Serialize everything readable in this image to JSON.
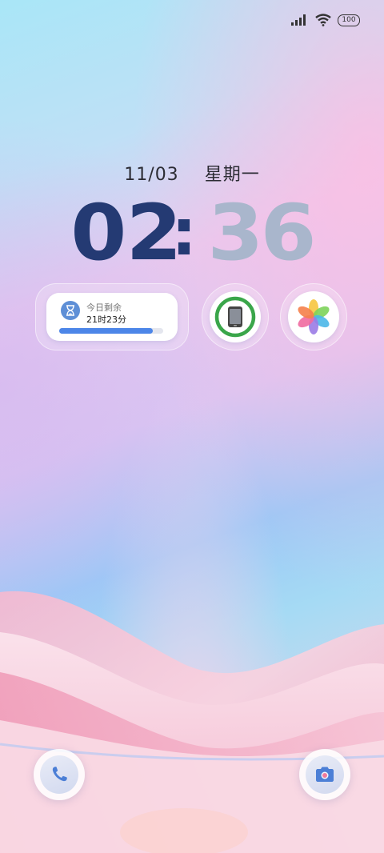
{
  "status_bar": {
    "signal_icon": "signal-icon",
    "wifi_icon": "wifi-icon",
    "battery_level": "100"
  },
  "lock_screen": {
    "date": "11/03",
    "weekday": "星期一",
    "clock": {
      "hour_digit_1": "0",
      "hour_digit_2": "2",
      "separator": ":",
      "minute_digit_1": "3",
      "minute_digit_2": "6",
      "hour_color": "#243a73",
      "minute_color": "#a9b6cc"
    }
  },
  "widgets": {
    "screen_time": {
      "icon": "hourglass-icon",
      "label": "今日剩余",
      "value": "21时23分",
      "progress": 0.9
    },
    "phone_manager": {
      "icon": "phone-manager-icon",
      "ring_color": "#3aa64a"
    },
    "gallery": {
      "icon": "gallery-flower-icon"
    }
  },
  "dock": {
    "phone_icon": "phone-icon",
    "camera_icon": "camera-icon",
    "accent": "#4c7fd6"
  }
}
